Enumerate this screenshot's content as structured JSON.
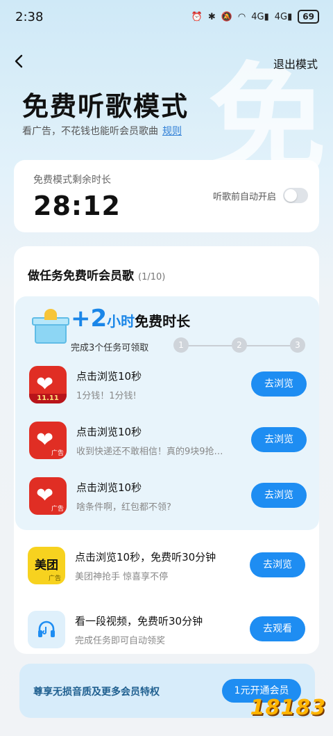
{
  "status_bar": {
    "time": "2:38",
    "battery": "69",
    "net1": "4G",
    "net2": "4G"
  },
  "nav": {
    "back_icon": "chevron-left-icon",
    "exit_label": "退出模式"
  },
  "hero": {
    "bg_glyph": "免",
    "title": "免费听歌模式",
    "subtitle": "看广告，不花钱也能听会员歌曲",
    "rules_link": "规则"
  },
  "timer": {
    "label": "免费模式剩余时长",
    "value": "28:12",
    "auto_label": "听歌前自动开启",
    "auto_on": false
  },
  "tasks": {
    "heading": "做任务免费听会员歌",
    "count": "(1/10)",
    "reward": {
      "plus": "+2",
      "unit": "小时",
      "rest": "免费时长",
      "sub": "完成3个任务可领取",
      "steps": [
        "1",
        "2",
        "3"
      ]
    },
    "items": [
      {
        "title": "点击浏览10秒",
        "desc": "1分钱！1分钱!",
        "button": "去浏览",
        "icon": "pinduoduo-icon",
        "band": "11.11"
      },
      {
        "title": "点击浏览10秒",
        "desc": "收到快递还不敢相信！真的9块9抢…",
        "button": "去浏览",
        "icon": "pinduoduo-icon"
      },
      {
        "title": "点击浏览10秒",
        "desc": "啥条件啊，红包都不领?",
        "button": "去浏览",
        "icon": "pinduoduo-icon"
      },
      {
        "title": "点击浏览10秒，免费听30分钟",
        "desc": "美团神抢手 惊喜享不停",
        "button": "去浏览",
        "icon": "meituan-icon",
        "icon_text": "美团"
      },
      {
        "title": "看一段视频，免费听30分钟",
        "desc": "完成任务即可自动领奖",
        "button": "去观看",
        "icon": "headphones-icon"
      }
    ],
    "ad_tag": "广告"
  },
  "vip": {
    "text": "尊享无损音质及更多会员特权",
    "button": "1元开通会员"
  },
  "watermark": "18183",
  "colors": {
    "accent": "#1e8df2",
    "pdd_red": "#e02e24",
    "meituan_yellow": "#f7d21f"
  }
}
